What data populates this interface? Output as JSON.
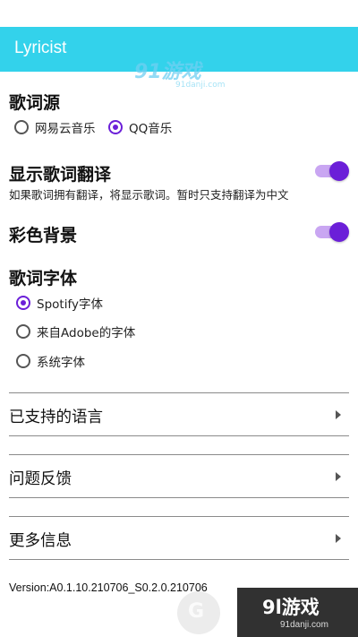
{
  "app_bar": {
    "title": "Lyricist"
  },
  "watermark": {
    "top_text": "91游戏",
    "top_sub": "91danji.com",
    "bottom_text": "9l游戏",
    "bottom_sub": "91danji.com",
    "logo_letter": "G"
  },
  "lyrics_source": {
    "title": "歌词源",
    "options": [
      "网易云音乐",
      "QQ音乐"
    ],
    "selected": "QQ音乐"
  },
  "show_translation": {
    "title": "显示歌词翻译",
    "description": "如果歌词拥有翻译，将显示歌词。暂时只支持翻译为中文",
    "enabled": true
  },
  "color_background": {
    "title": "彩色背景",
    "enabled": true
  },
  "lyrics_font": {
    "title": "歌词字体",
    "options": [
      "Spotify字体",
      "来自Adobe的字体",
      "系统字体"
    ],
    "selected": "Spotify字体"
  },
  "menu": [
    {
      "label": "已支持的语言"
    },
    {
      "label": "问题反馈"
    },
    {
      "label": "更多信息"
    }
  ],
  "version": "Version:A0.1.10.210706_S0.2.0.210706",
  "colors": {
    "app_bar": "#33d2eb",
    "accent": "#6b1fd8",
    "switch_track": "#c9a6f2"
  }
}
